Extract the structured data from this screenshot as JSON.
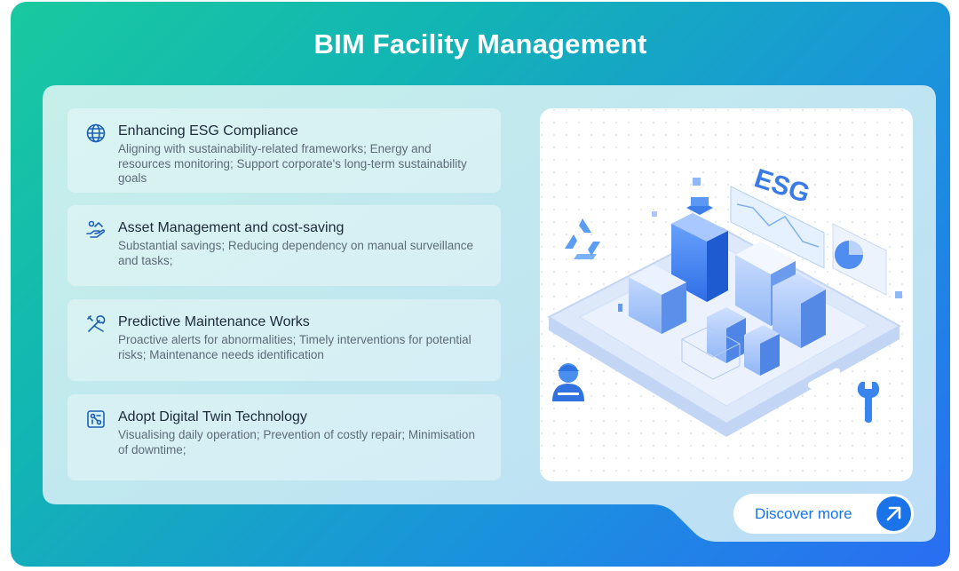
{
  "title": "BIM Facility Management",
  "cards": [
    {
      "icon": "globe-icon",
      "title": "Enhancing ESG Compliance",
      "description": "Aligning with sustainability-related frameworks; Energy and resources monitoring; Support corporate's long-term sustainability goals"
    },
    {
      "icon": "hand-coin-icon",
      "title": "Asset Management and cost-saving",
      "description": "Substantial savings;  Reducing dependency on manual surveillance and tasks;"
    },
    {
      "icon": "tools-icon",
      "title": "Predictive Maintenance Works",
      "description": "Proactive alerts for abnormalities; Timely interventions for potential risks; Maintenance needs identification"
    },
    {
      "icon": "digital-twin-icon",
      "title": "Adopt Digital Twin Technology",
      "description": "Visualising daily operation; Prevention of costly repair; Minimisation of downtime;"
    }
  ],
  "illustration": {
    "label": "ESG"
  },
  "cta": {
    "label": "Discover more",
    "icon": "arrow-up-right-icon"
  },
  "colors": {
    "gradient_start": "#19c9a0",
    "gradient_end": "#2a6df2",
    "accent": "#1a73e8",
    "title_text": "#ffffff"
  }
}
